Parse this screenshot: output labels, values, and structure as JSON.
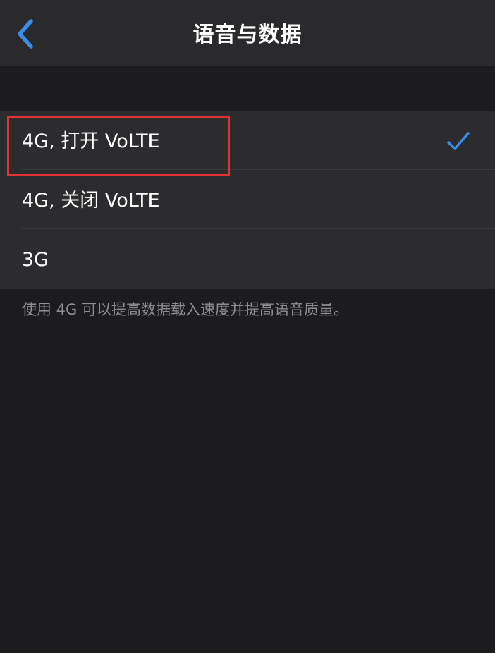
{
  "navbar": {
    "title": "语音与数据",
    "back_icon": "chevron-left-icon"
  },
  "options": [
    {
      "label": "4G, 打开 VoLTE",
      "selected": true
    },
    {
      "label": "4G, 关闭 VoLTE",
      "selected": false
    },
    {
      "label": "3G",
      "selected": false
    }
  ],
  "footer": {
    "text": "使用 4G 可以提高数据载入速度并提高语音质量。"
  },
  "colors": {
    "background": "#1c1c1e",
    "navbar": "#2a2a2c",
    "group": "#2c2c2e",
    "accent": "#3a8ee6",
    "highlight": "#e43234",
    "footer_text": "#8e8e93"
  }
}
